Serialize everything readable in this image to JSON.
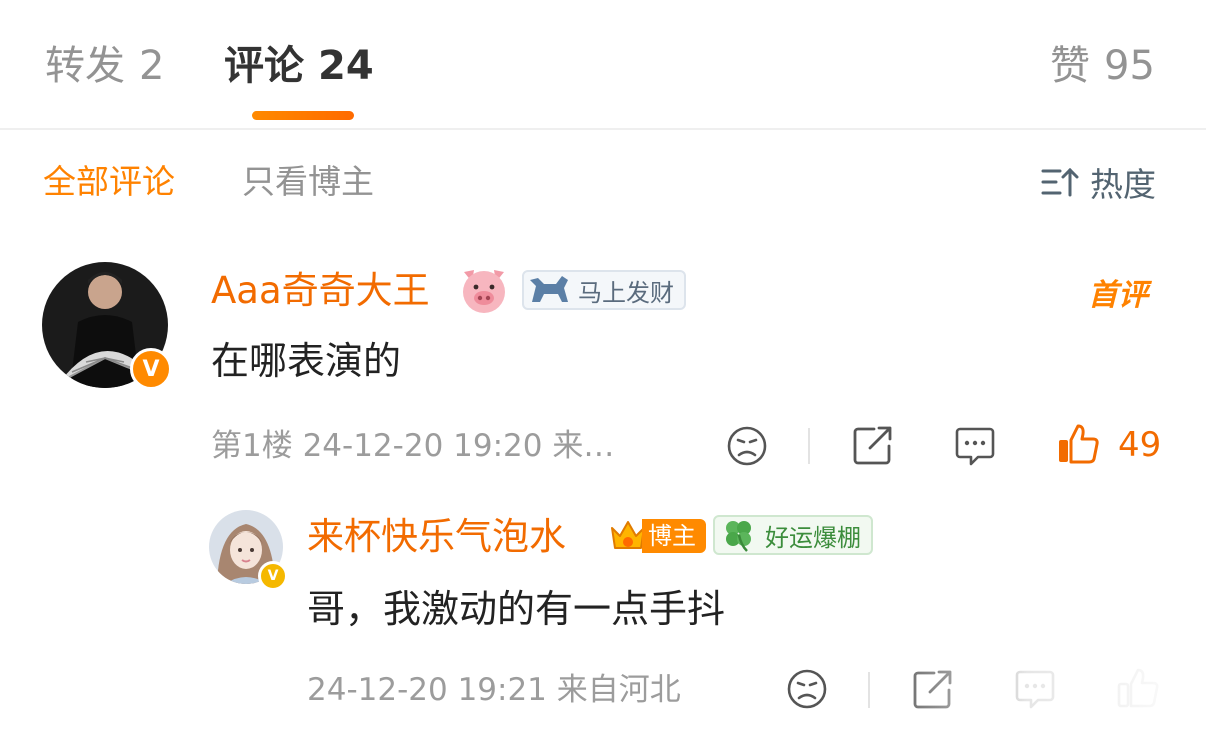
{
  "tabs": [
    {
      "label": "转发",
      "count": "2"
    },
    {
      "label": "评论",
      "count": "24"
    },
    {
      "label": "赞",
      "count": "95"
    }
  ],
  "filters": {
    "all": "全部评论",
    "author_only": "只看博主",
    "sort": "热度"
  },
  "comment": {
    "username": "Aaa奇奇大王",
    "emoji": "pig-face",
    "badge_label": "马上发财",
    "first_tag": "首评",
    "text": "在哪表演的",
    "meta": "第1楼 24-12-20 19:20 来…",
    "likes": "49",
    "verified_badge": "V"
  },
  "reply": {
    "username": "来杯快乐气泡水",
    "author_tag": "博主",
    "badge_label": "好运爆棚",
    "text": "哥，我激动的有一点手抖",
    "meta": "24-12-20 19:21 来自河北",
    "verified_badge": "V"
  },
  "colors": {
    "accent": "#ff8200",
    "username": "#f26b00",
    "muted": "#939393"
  }
}
